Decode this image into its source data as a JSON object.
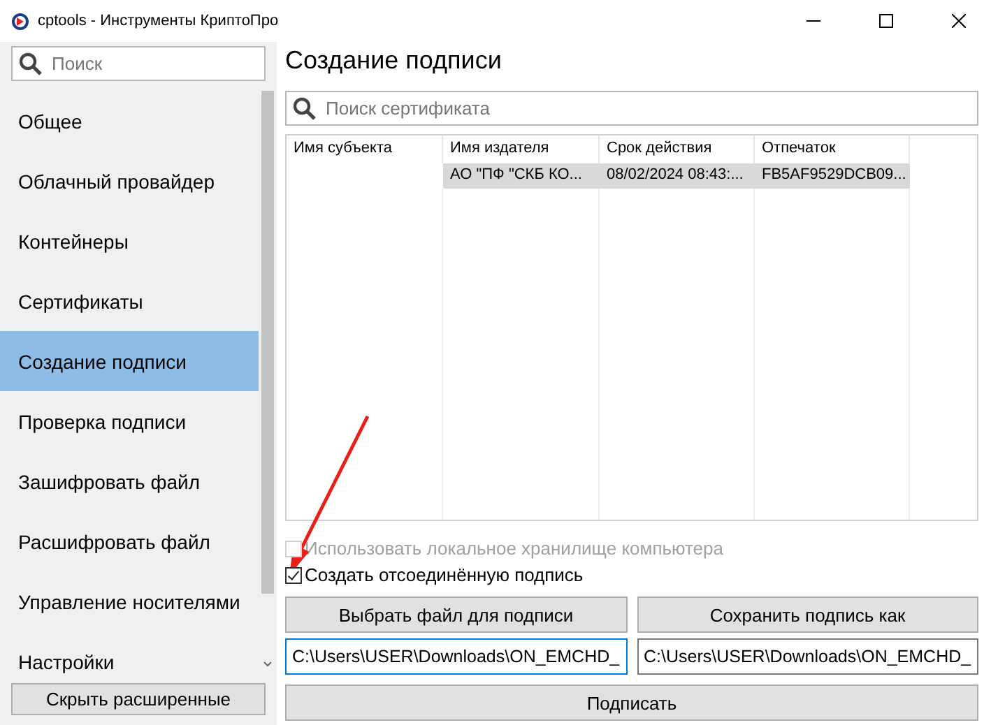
{
  "window": {
    "title": "cptools - Инструменты КриптоПро"
  },
  "sidebar": {
    "search": {
      "placeholder": "Поиск"
    },
    "items": [
      {
        "label": "Общее",
        "selected": false
      },
      {
        "label": "Облачный провайдер",
        "selected": false
      },
      {
        "label": "Контейнеры",
        "selected": false
      },
      {
        "label": "Сертификаты",
        "selected": false
      },
      {
        "label": "Создание подписи",
        "selected": true
      },
      {
        "label": "Проверка подписи",
        "selected": false
      },
      {
        "label": "Зашифровать файл",
        "selected": false
      },
      {
        "label": "Расшифровать файл",
        "selected": false
      },
      {
        "label": "Управление носителями",
        "selected": false
      },
      {
        "label": "Настройки",
        "selected": false
      }
    ],
    "hide_button": "Скрыть расширенные"
  },
  "main": {
    "heading": "Создание подписи",
    "search": {
      "placeholder": "Поиск сертификата"
    },
    "table": {
      "columns": [
        "Имя субъекта",
        "Имя издателя",
        "Срок действия",
        "Отпечаток"
      ],
      "rows": [
        {
          "selected": true,
          "cells": [
            "",
            "АО \"ПФ \"СКБ КО...",
            "08/02/2024 08:43:...",
            "FB5AF9529DCB09..."
          ]
        }
      ]
    },
    "options": [
      {
        "label": "Использовать локальное хранилище компьютера",
        "checked": false,
        "disabled": true
      },
      {
        "label": "Создать отсоединённую подпись",
        "checked": true,
        "disabled": false
      }
    ],
    "choose_button": "Выбрать файл для подписи",
    "save_button": "Сохранить подпись как",
    "input_path": "C:\\Users\\USER\\Downloads\\ON_EMCHD_",
    "output_path": "C:\\Users\\USER\\Downloads\\ON_EMCHD_",
    "sign_button": "Подписать"
  }
}
